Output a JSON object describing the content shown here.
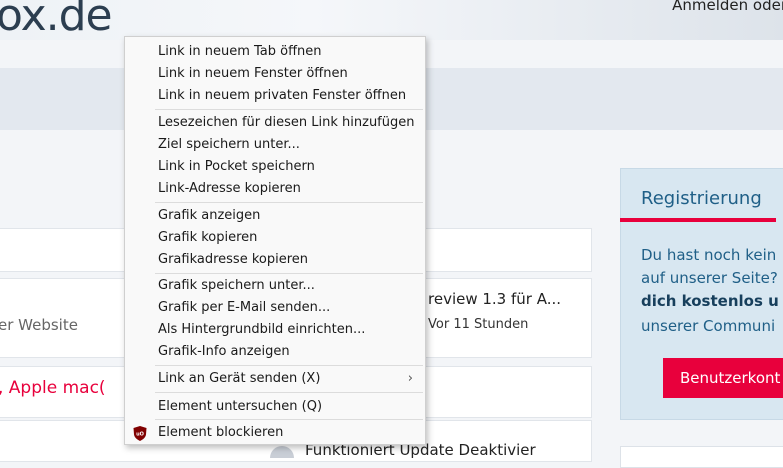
{
  "header": {
    "logo_text": "ox.de",
    "login_text": "Anmelden oder"
  },
  "content": {
    "ext_text": "er Website",
    "preview_title": "review 1.3 für A...",
    "preview_time": "Vor 11 Stunden",
    "red_headline": ", Apple mac(",
    "bottom_headline": "Funktioniert Update Deaktivier"
  },
  "sidebar": {
    "title": "Registrierung",
    "line1": "Du hast noch kein",
    "line2": "auf unserer Seite?",
    "line3": "dich kostenlos u",
    "line4": "unserer Communi",
    "button": "Benutzerkont",
    "accent_color": "#e8003c",
    "title_color": "#1f5f87"
  },
  "context_menu": {
    "group1": [
      "Link in neuem Tab öffnen",
      "Link in neuem Fenster öffnen",
      "Link in neuem privaten Fenster öffnen"
    ],
    "group2": [
      "Lesezeichen für diesen Link hinzufügen",
      "Ziel speichern unter...",
      "Link in Pocket speichern",
      "Link-Adresse kopieren"
    ],
    "group3": [
      "Grafik anzeigen",
      "Grafik kopieren",
      "Grafikadresse kopieren"
    ],
    "group4": [
      "Grafik speichern unter...",
      "Grafik per E-Mail senden...",
      "Als Hintergrundbild einrichten...",
      "Grafik-Info anzeigen"
    ],
    "send_to_device": "Link an Gerät senden (X)",
    "send_to_device_arrow": "›",
    "inspect": "Element untersuchen (Q)",
    "block": "Element blockieren",
    "block_icon": "ublock-origin-icon"
  }
}
